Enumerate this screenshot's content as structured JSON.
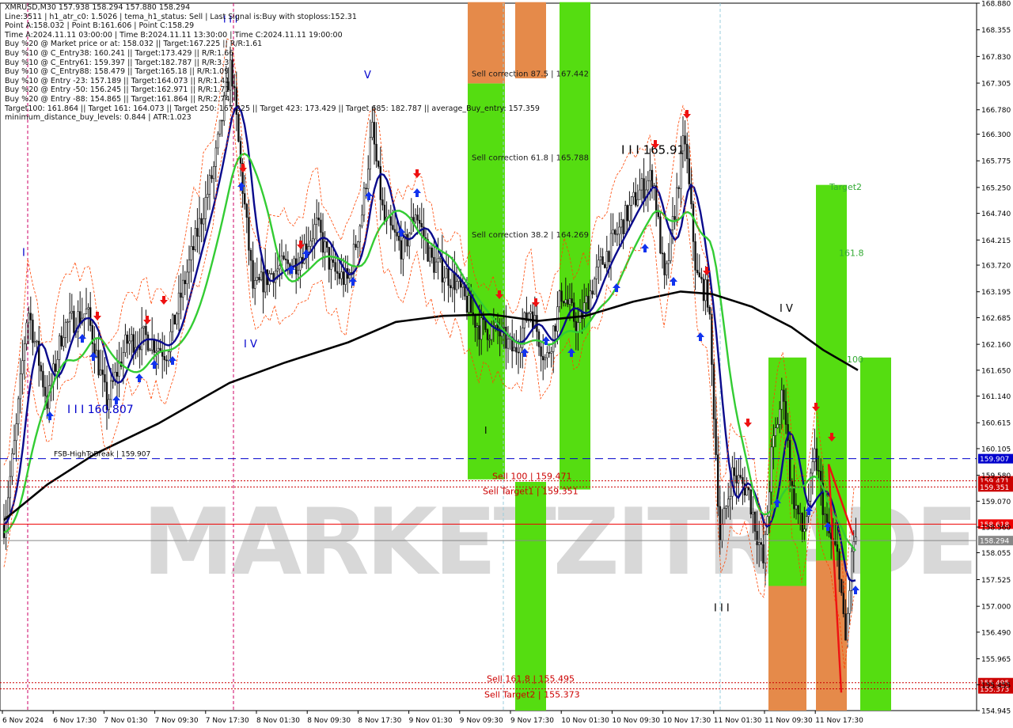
{
  "window": {
    "title": "XMRUSD,M30  157.938 158.294 157.880 158.294"
  },
  "info_lines": [
    "XMRUSD,M30  157.938 158.294 157.880 158.294",
    "Line:3511 | h1_atr_c0: 1.5026 | tema_h1_status: Sell | Last Signal is:Buy with stoploss:152.31",
    "Point A:158.032 | Point B:161.606 | Point C:158.29",
    "Time A:2024.11.11 03:00:00 | Time B:2024.11.11 13:30:00 | Time C:2024.11.11 19:00:00",
    "Buy %20 @ Market price or at: 158.032 || Target:167.225 || R/R:1.61",
    "Buy %10 @ C_Entry38: 160.241 || Target:173.429 || R/R:1.66",
    "Buy %10 @ C_Entry61: 159.397 || Target:182.787 || R/R:3.3",
    "Buy %10 @ C_Entry88: 158.479 || Target:165.18 || R/R:1.09",
    "Buy %10 @ Entry -23: 157.189 || Target:164.073 || R/R:1.41",
    "Buy %20 @ Entry -50: 156.245 || Target:162.971 || R/R:1.71",
    "Buy %20 @ Entry -88: 154.865 || Target:161.864 || R/R:2.74",
    "Target100: 161.864 || Target 161: 164.073 || Target 250: 167.225 || Target 423: 173.429 || Target 685: 182.787 || average_Buy_entry: 157.359",
    "minimum_distance_buy_levels: 0.844 | ATR:1.023"
  ],
  "colors": {
    "background": "#ffffff",
    "grid": "#c8c8c8",
    "candle": "#111111",
    "ema_fast": "#0a0a8c",
    "ema_mid": "#33cc33",
    "ema_slow": "#000000",
    "fib_channel": "#ff4400",
    "green_zone": "#55dd11",
    "orange_zone": "#e58a4a",
    "buy_arrow": "#1133ee",
    "sell_arrow": "#ee1111",
    "price_label_blue": "#0000cc",
    "price_label_red": "#dd0000",
    "watermark": "#d8d8d8"
  },
  "watermark_text": "MARKETZITRADE",
  "chart_data": {
    "type": "candlestick",
    "symbol": "XMRUSD",
    "timeframe": "M30",
    "ylim": [
      154.945,
      168.88
    ],
    "y_ticks": [
      "168.880",
      "168.355",
      "167.830",
      "167.305",
      "166.780",
      "166.300",
      "165.775",
      "165.250",
      "164.740",
      "164.215",
      "163.720",
      "163.195",
      "162.685",
      "162.160",
      "161.650",
      "161.140",
      "160.615",
      "160.105",
      "159.580",
      "159.070",
      "158.560",
      "158.055",
      "157.525",
      "157.000",
      "156.490",
      "155.965",
      "155.455",
      "154.945"
    ],
    "x_tick_labels": [
      "6 Nov 2024",
      "6 Nov 17:30",
      "7 Nov 01:30",
      "7 Nov 09:30",
      "7 Nov 17:30",
      "8 Nov 01:30",
      "8 Nov 09:30",
      "8 Nov 17:30",
      "9 Nov 01:30",
      "9 Nov 09:30",
      "9 Nov 17:30",
      "10 Nov 01:30",
      "10 Nov 09:30",
      "10 Nov 17:30",
      "11 Nov 01:30",
      "11 Nov 09:30",
      "11 Nov 17:30"
    ],
    "horizontal_levels": [
      {
        "price": 159.907,
        "label": "159.907",
        "text": "FSB-HighToBreak | 159.907",
        "color": "#0000cc",
        "style": "dashed"
      },
      {
        "price": 159.471,
        "label": "159.471",
        "text": "Sell 100 | 159.471",
        "color": "#cc0000",
        "style": "dotted"
      },
      {
        "price": 159.351,
        "label": "159.351",
        "text": "Sell Target1 | 159.351",
        "color": "#cc0000",
        "style": "dotted"
      },
      {
        "price": 158.618,
        "label": "158.618",
        "text": "",
        "color": "#ee0000",
        "style": "solid"
      },
      {
        "price": 158.294,
        "label": "158.294",
        "text": "",
        "color": "#888888",
        "style": "solid"
      },
      {
        "price": 155.495,
        "label": "155.495",
        "text": "Sell 161.8 | 155.495",
        "color": "#cc0000",
        "style": "dotted"
      },
      {
        "price": 155.373,
        "label": "155.373",
        "text": "Sell Target2 | 155.373",
        "color": "#cc0000",
        "style": "dotted"
      }
    ],
    "annotations": [
      {
        "text": "Sell correction 87.5 | 167.442",
        "price": 167.442
      },
      {
        "text": "Sell correction 61.8 | 165.788",
        "price": 165.788
      },
      {
        "text": "Sell correction 38.2 | 164.269",
        "price": 164.269
      },
      {
        "text": "I I I 165.91",
        "price": 165.91
      },
      {
        "text": "I I I 160.807",
        "price": 160.807
      },
      {
        "text": "Target2",
        "price": 165.2
      },
      {
        "text": "161.8",
        "price": 163.9
      },
      {
        "text": "100",
        "price": 161.8
      },
      {
        "text": "I V",
        "price": 162.8
      },
      {
        "text": "I V",
        "price": 162.1
      },
      {
        "text": "V",
        "price": 167.4
      },
      {
        "text": "I I I",
        "price": 168.5
      },
      {
        "text": "I I I",
        "price": 156.9
      },
      {
        "text": "I",
        "price": 163.9
      },
      {
        "text": "I",
        "price": 160.4
      }
    ]
  }
}
